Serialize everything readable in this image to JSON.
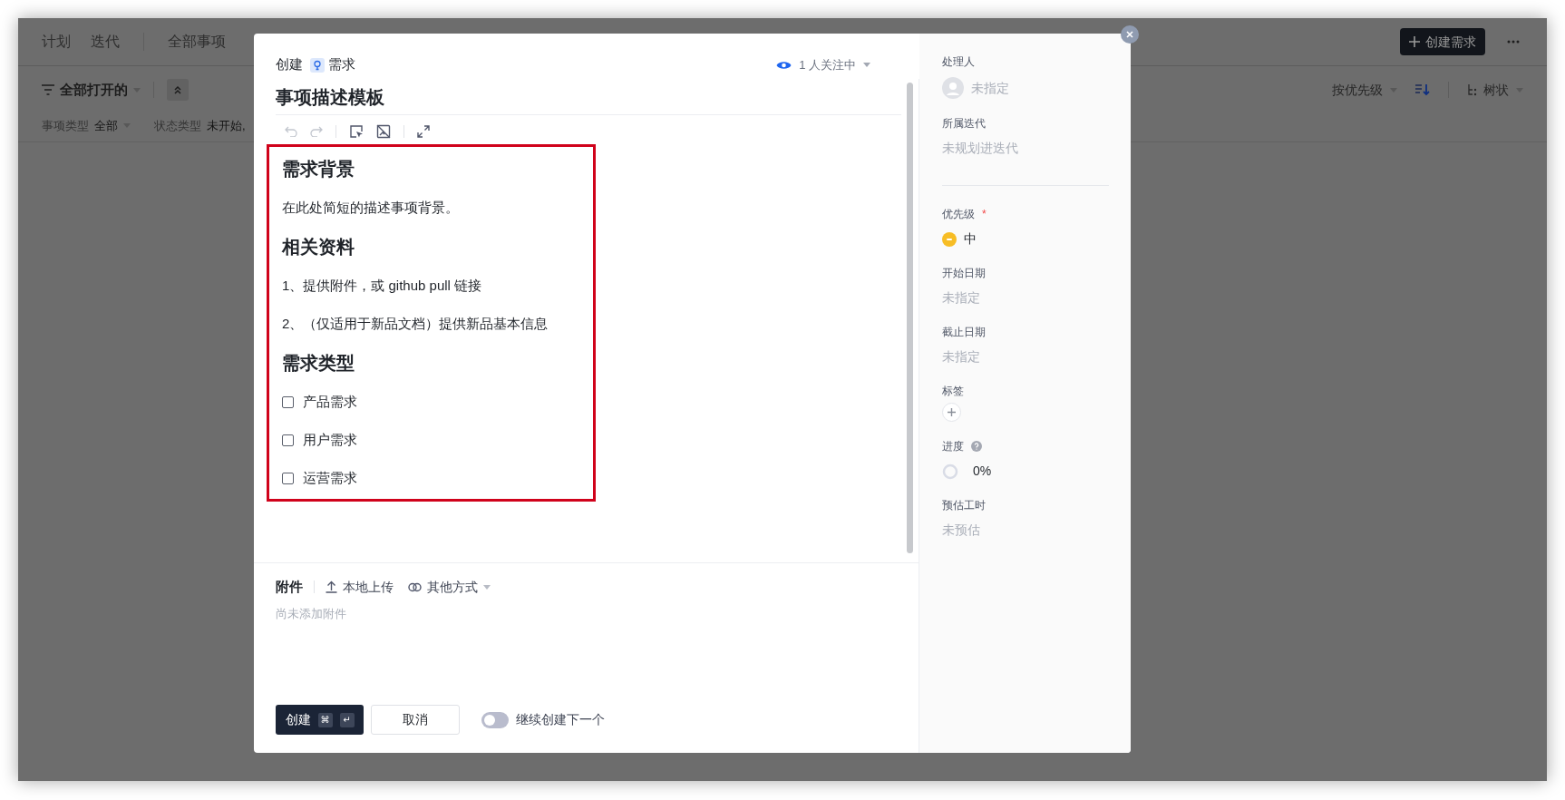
{
  "background": {
    "nav_tabs": [
      {
        "label": "计划"
      },
      {
        "label": "迭代"
      },
      {
        "label": "全部事项"
      }
    ],
    "create_button": "创建需求",
    "filter": {
      "view": "全部打开的",
      "conditions": [
        {
          "label": "事项类型",
          "value": "全部",
          "dropdown": true
        },
        {
          "label": "状态类型",
          "value": "未开始,"
        }
      ]
    },
    "sort": "按优先级",
    "layout": "树状"
  },
  "dialog": {
    "header": {
      "action": "创建",
      "type": "需求",
      "watchers": "1 人关注中"
    },
    "title": "事项描述模板",
    "content": [
      {
        "kind": "heading",
        "text": "需求背景"
      },
      {
        "kind": "paragraph",
        "text": "在此处简短的描述事项背景。"
      },
      {
        "kind": "heading",
        "text": "相关资料"
      },
      {
        "kind": "paragraph",
        "text": "1、提供附件，或 github pull 链接"
      },
      {
        "kind": "paragraph",
        "text": "2、（仅适用于新品文档）提供新品基本信息"
      },
      {
        "kind": "heading",
        "text": "需求类型"
      },
      {
        "kind": "checkbox",
        "text": "产品需求",
        "checked": false
      },
      {
        "kind": "checkbox",
        "text": "用户需求",
        "checked": false
      },
      {
        "kind": "checkbox",
        "text": "运营需求",
        "checked": false
      }
    ],
    "attachments": {
      "title": "附件",
      "upload": "本地上传",
      "other": "其他方式",
      "empty": "尚未添加附件"
    },
    "footer": {
      "create": "创建",
      "shortcut": [
        "⌘",
        "↵"
      ],
      "cancel": "取消",
      "continue_toggle": {
        "label": "继续创建下一个",
        "on": false
      }
    },
    "fields": [
      {
        "kind": "person",
        "label": "处理人",
        "placeholder": "未指定"
      },
      {
        "kind": "text",
        "label": "所属迭代",
        "placeholder": "未规划进迭代",
        "divider_after": true
      },
      {
        "kind": "priority",
        "label": "优先级",
        "required_mark": "*",
        "value": "中"
      },
      {
        "kind": "text",
        "label": "开始日期",
        "placeholder": "未指定"
      },
      {
        "kind": "text",
        "label": "截止日期",
        "placeholder": "未指定"
      },
      {
        "kind": "tags",
        "label": "标签"
      },
      {
        "kind": "progress",
        "label": "进度",
        "help": true,
        "value": "0%"
      },
      {
        "kind": "text",
        "label": "预估工时",
        "placeholder": "未预估"
      }
    ]
  }
}
